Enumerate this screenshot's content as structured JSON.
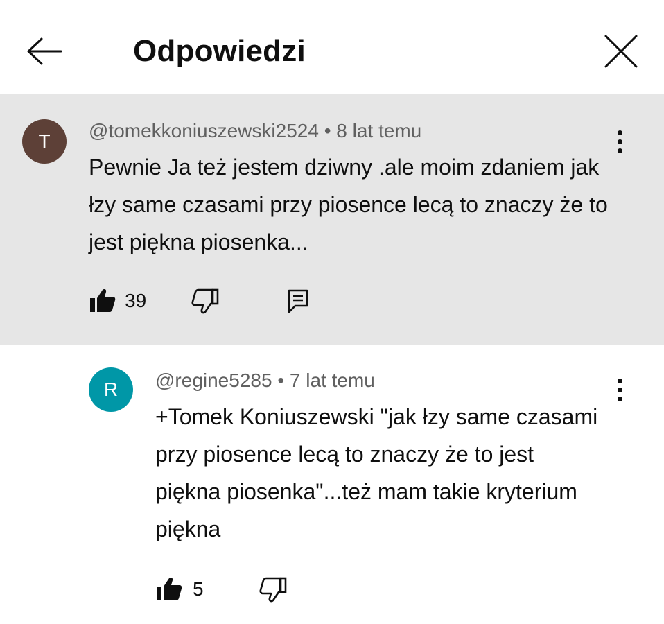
{
  "header": {
    "title": "Odpowiedzi"
  },
  "icons": {
    "back": "arrow-left-icon",
    "close": "close-icon",
    "more": "more-vertical-icon",
    "like": "thumbs-up-filled-icon",
    "dislike": "thumbs-down-icon",
    "reply": "reply-comment-icon"
  },
  "parent_comment": {
    "avatar_letter": "T",
    "avatar_color": "#5d4037",
    "author": "@tomekkoniuszewski2524",
    "time": "8 lat temu",
    "separator": "•",
    "text": "Pewnie Ja też jestem dziwny .ale moim zdaniem jak łzy same czasami przy piosence lecą to znaczy że to jest piękna piosenka...",
    "likes": "39",
    "background": "#e6e6e6"
  },
  "reply_comment": {
    "avatar_letter": "R",
    "avatar_color": "#0097a7",
    "author": "@regine5285",
    "time": "7 lat temu",
    "separator": "•",
    "text": "+Tomek Koniuszewski \"jak łzy same czasami przy piosence lecą to znaczy że to jest piękna piosenka\"...też mam takie kryterium piękna",
    "likes": "5"
  }
}
